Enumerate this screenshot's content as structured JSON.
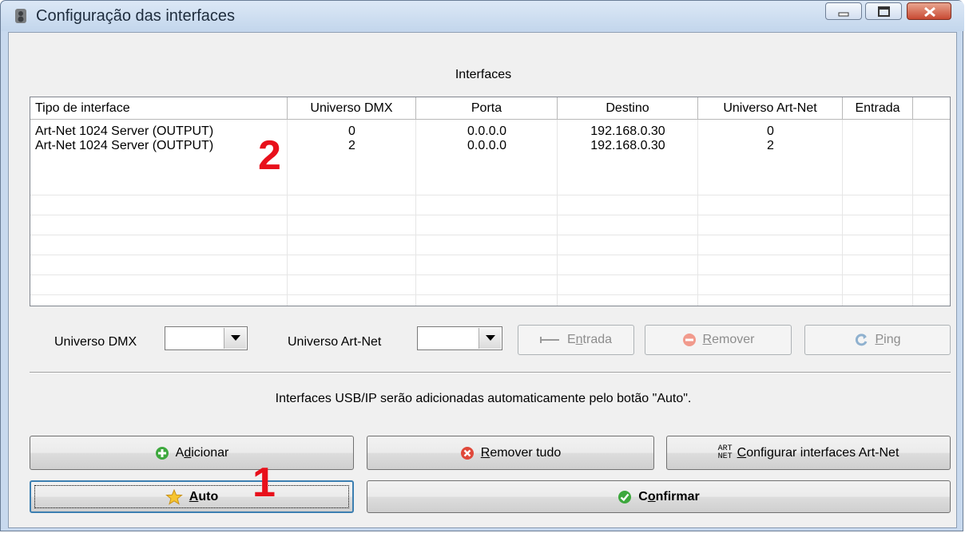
{
  "window": {
    "title": "Configuração das interfaces",
    "icon": "speaker-app-icon",
    "controls": [
      "minimize-icon",
      "maximize-icon",
      "close-icon"
    ]
  },
  "section": {
    "title": "Interfaces"
  },
  "table": {
    "columns": [
      "Tipo de interface",
      "Universo DMX",
      "Porta",
      "Destino",
      "Universo Art-Net",
      "Entrada"
    ],
    "rows": [
      [
        "Art-Net 1024 Server (OUTPUT)",
        "0",
        "0.0.0.0",
        "192.168.0.30",
        "0",
        ""
      ],
      [
        "Art-Net 1024 Server (OUTPUT)",
        "2",
        "0.0.0.0",
        "192.168.0.30",
        "2",
        ""
      ]
    ]
  },
  "controls": {
    "universo_dmx_label": "Universo DMX",
    "universo_dmx_value": "",
    "universo_artnet_label": "Universo Art-Net",
    "universo_artnet_value": "",
    "entrada": {
      "pre": "E",
      "ul": "n",
      "post": "trada",
      "icon": "arrow-in-icon"
    },
    "remover": {
      "pre": "",
      "ul": "R",
      "post": "emover",
      "icon": "minus-circle-icon"
    },
    "ping": {
      "pre": "",
      "ul": "P",
      "post": "ing",
      "icon": "refresh-icon"
    }
  },
  "info_text": "Interfaces USB/IP serão adicionadas automaticamente pelo botão \"Auto\".",
  "buttons": {
    "adicionar": {
      "pre": "A",
      "ul": "d",
      "post": "icionar",
      "icon": "plus-circle-icon"
    },
    "remover_tudo": {
      "pre": "",
      "ul": "R",
      "post": "emover tudo",
      "icon": "x-circle-icon"
    },
    "configurar": {
      "pre": "",
      "ul": "C",
      "post": "onfigurar interfaces Art-Net",
      "icon": "artnet-logo-icon",
      "logo_top": "ART",
      "logo_bottom": "NET"
    },
    "auto": {
      "pre": "",
      "ul": "A",
      "post": "uto",
      "icon": "star-icon"
    },
    "confirmar": {
      "pre": "C",
      "ul": "o",
      "post": "nfirmar",
      "icon": "check-circle-icon"
    }
  },
  "annotations": {
    "marker_1": "1",
    "marker_2": "2"
  },
  "colors": {
    "marker": "#e8101b",
    "accent": "#3c7fb1",
    "close": "#c84a33"
  }
}
